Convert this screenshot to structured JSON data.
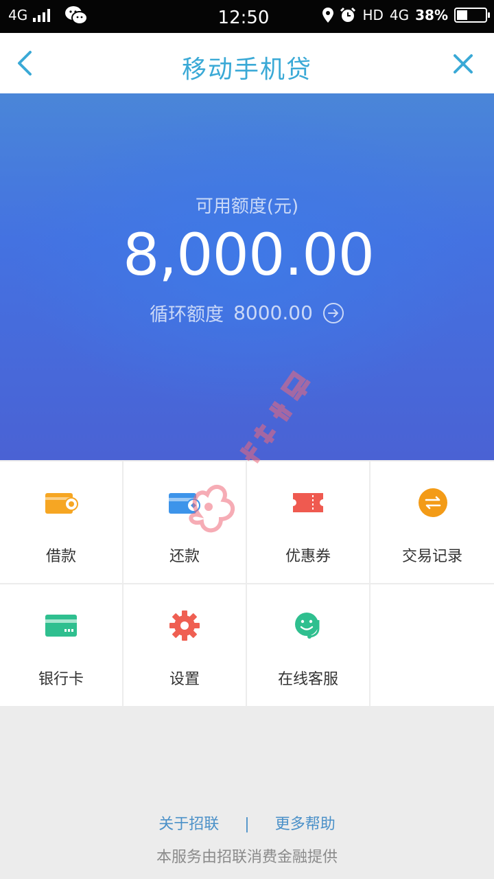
{
  "status_bar": {
    "network": "4G",
    "time": "12:50",
    "hd": "HD",
    "network2": "4G",
    "battery_pct": "38%",
    "battery_level": 0.38,
    "icons": [
      "signal-icon",
      "wechat-icon",
      "location-icon",
      "alarm-icon",
      "battery-icon"
    ]
  },
  "nav": {
    "title": "移动手机贷",
    "back_icon": "chevron-left-icon",
    "close_icon": "close-icon",
    "accent": "#3aa9d6"
  },
  "credit": {
    "label": "可用额度(元)",
    "amount": "8,000.00",
    "revolving_label": "循环额度",
    "revolving_value": "8000.00",
    "arrow_icon": "circle-arrow-right-icon",
    "banner_color": "#4472e1"
  },
  "menu": [
    {
      "label": "借款",
      "icon": "wallet-icon",
      "color": "#f6a623"
    },
    {
      "label": "还款",
      "icon": "card-repay-icon",
      "color": "#3d94ea"
    },
    {
      "label": "优惠券",
      "icon": "coupon-icon",
      "color": "#ef5a50"
    },
    {
      "label": "交易记录",
      "icon": "exchange-icon",
      "color": "#f39b17"
    },
    {
      "label": "银行卡",
      "icon": "bank-card-icon",
      "color": "#2fbf8f"
    },
    {
      "label": "设置",
      "icon": "gear-icon",
      "color": "#ef5f52"
    },
    {
      "label": "在线客服",
      "icon": "support-icon",
      "color": "#2fbf8f"
    }
  ],
  "footer": {
    "about": "关于招联",
    "separator": "|",
    "help": "更多帮助",
    "note": "本服务由招联消费金融提供",
    "link_color": "#4a90c8"
  },
  "watermark": {
    "text": "卡农社区"
  }
}
